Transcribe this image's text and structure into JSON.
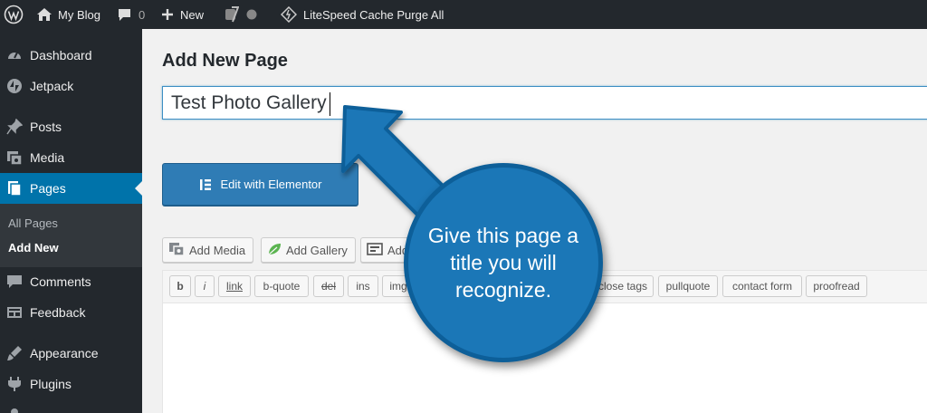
{
  "adminbar": {
    "site_name": "My Blog",
    "comments_count": "0",
    "new_label": "New",
    "litespeed_label": "LiteSpeed Cache Purge All",
    "icons": [
      "wordpress-logo-icon",
      "home-icon",
      "comment-bubble-icon",
      "plus-icon",
      "yoast-icon",
      "status-dot-icon",
      "litespeed-icon"
    ]
  },
  "sidebar": {
    "items": [
      {
        "label": "Dashboard",
        "icon": "dashboard-icon"
      },
      {
        "label": "Jetpack",
        "icon": "jetpack-icon"
      },
      {
        "label": "Posts",
        "icon": "pin-icon"
      },
      {
        "label": "Media",
        "icon": "media-icon"
      },
      {
        "label": "Pages",
        "icon": "pages-icon",
        "current": true
      },
      {
        "label": "Comments",
        "icon": "comments-icon"
      },
      {
        "label": "Feedback",
        "icon": "feedback-icon"
      },
      {
        "label": "Appearance",
        "icon": "appearance-icon"
      },
      {
        "label": "Plugins",
        "icon": "plugins-icon"
      }
    ],
    "submenu": [
      {
        "label": "All Pages"
      },
      {
        "label": "Add New",
        "current": true
      }
    ]
  },
  "main": {
    "page_title": "Add New Page",
    "title_value": "Test Photo Gallery",
    "elementor_label": "Edit with Elementor",
    "media_buttons": [
      {
        "label": "Add Media"
      },
      {
        "label": "Add Gallery"
      },
      {
        "label": "Add"
      }
    ],
    "quicktags": [
      "b",
      "i",
      "link",
      "b-quote",
      "del",
      "ins",
      "img",
      "close tags",
      "pullquote",
      "contact form",
      "proofread"
    ]
  },
  "callout": {
    "text": "Give this page a title you will recognize."
  },
  "colors": {
    "adminbar_bg": "#23282d",
    "accent_blue": "#0073aa",
    "callout_blue": "#1b77b7"
  }
}
